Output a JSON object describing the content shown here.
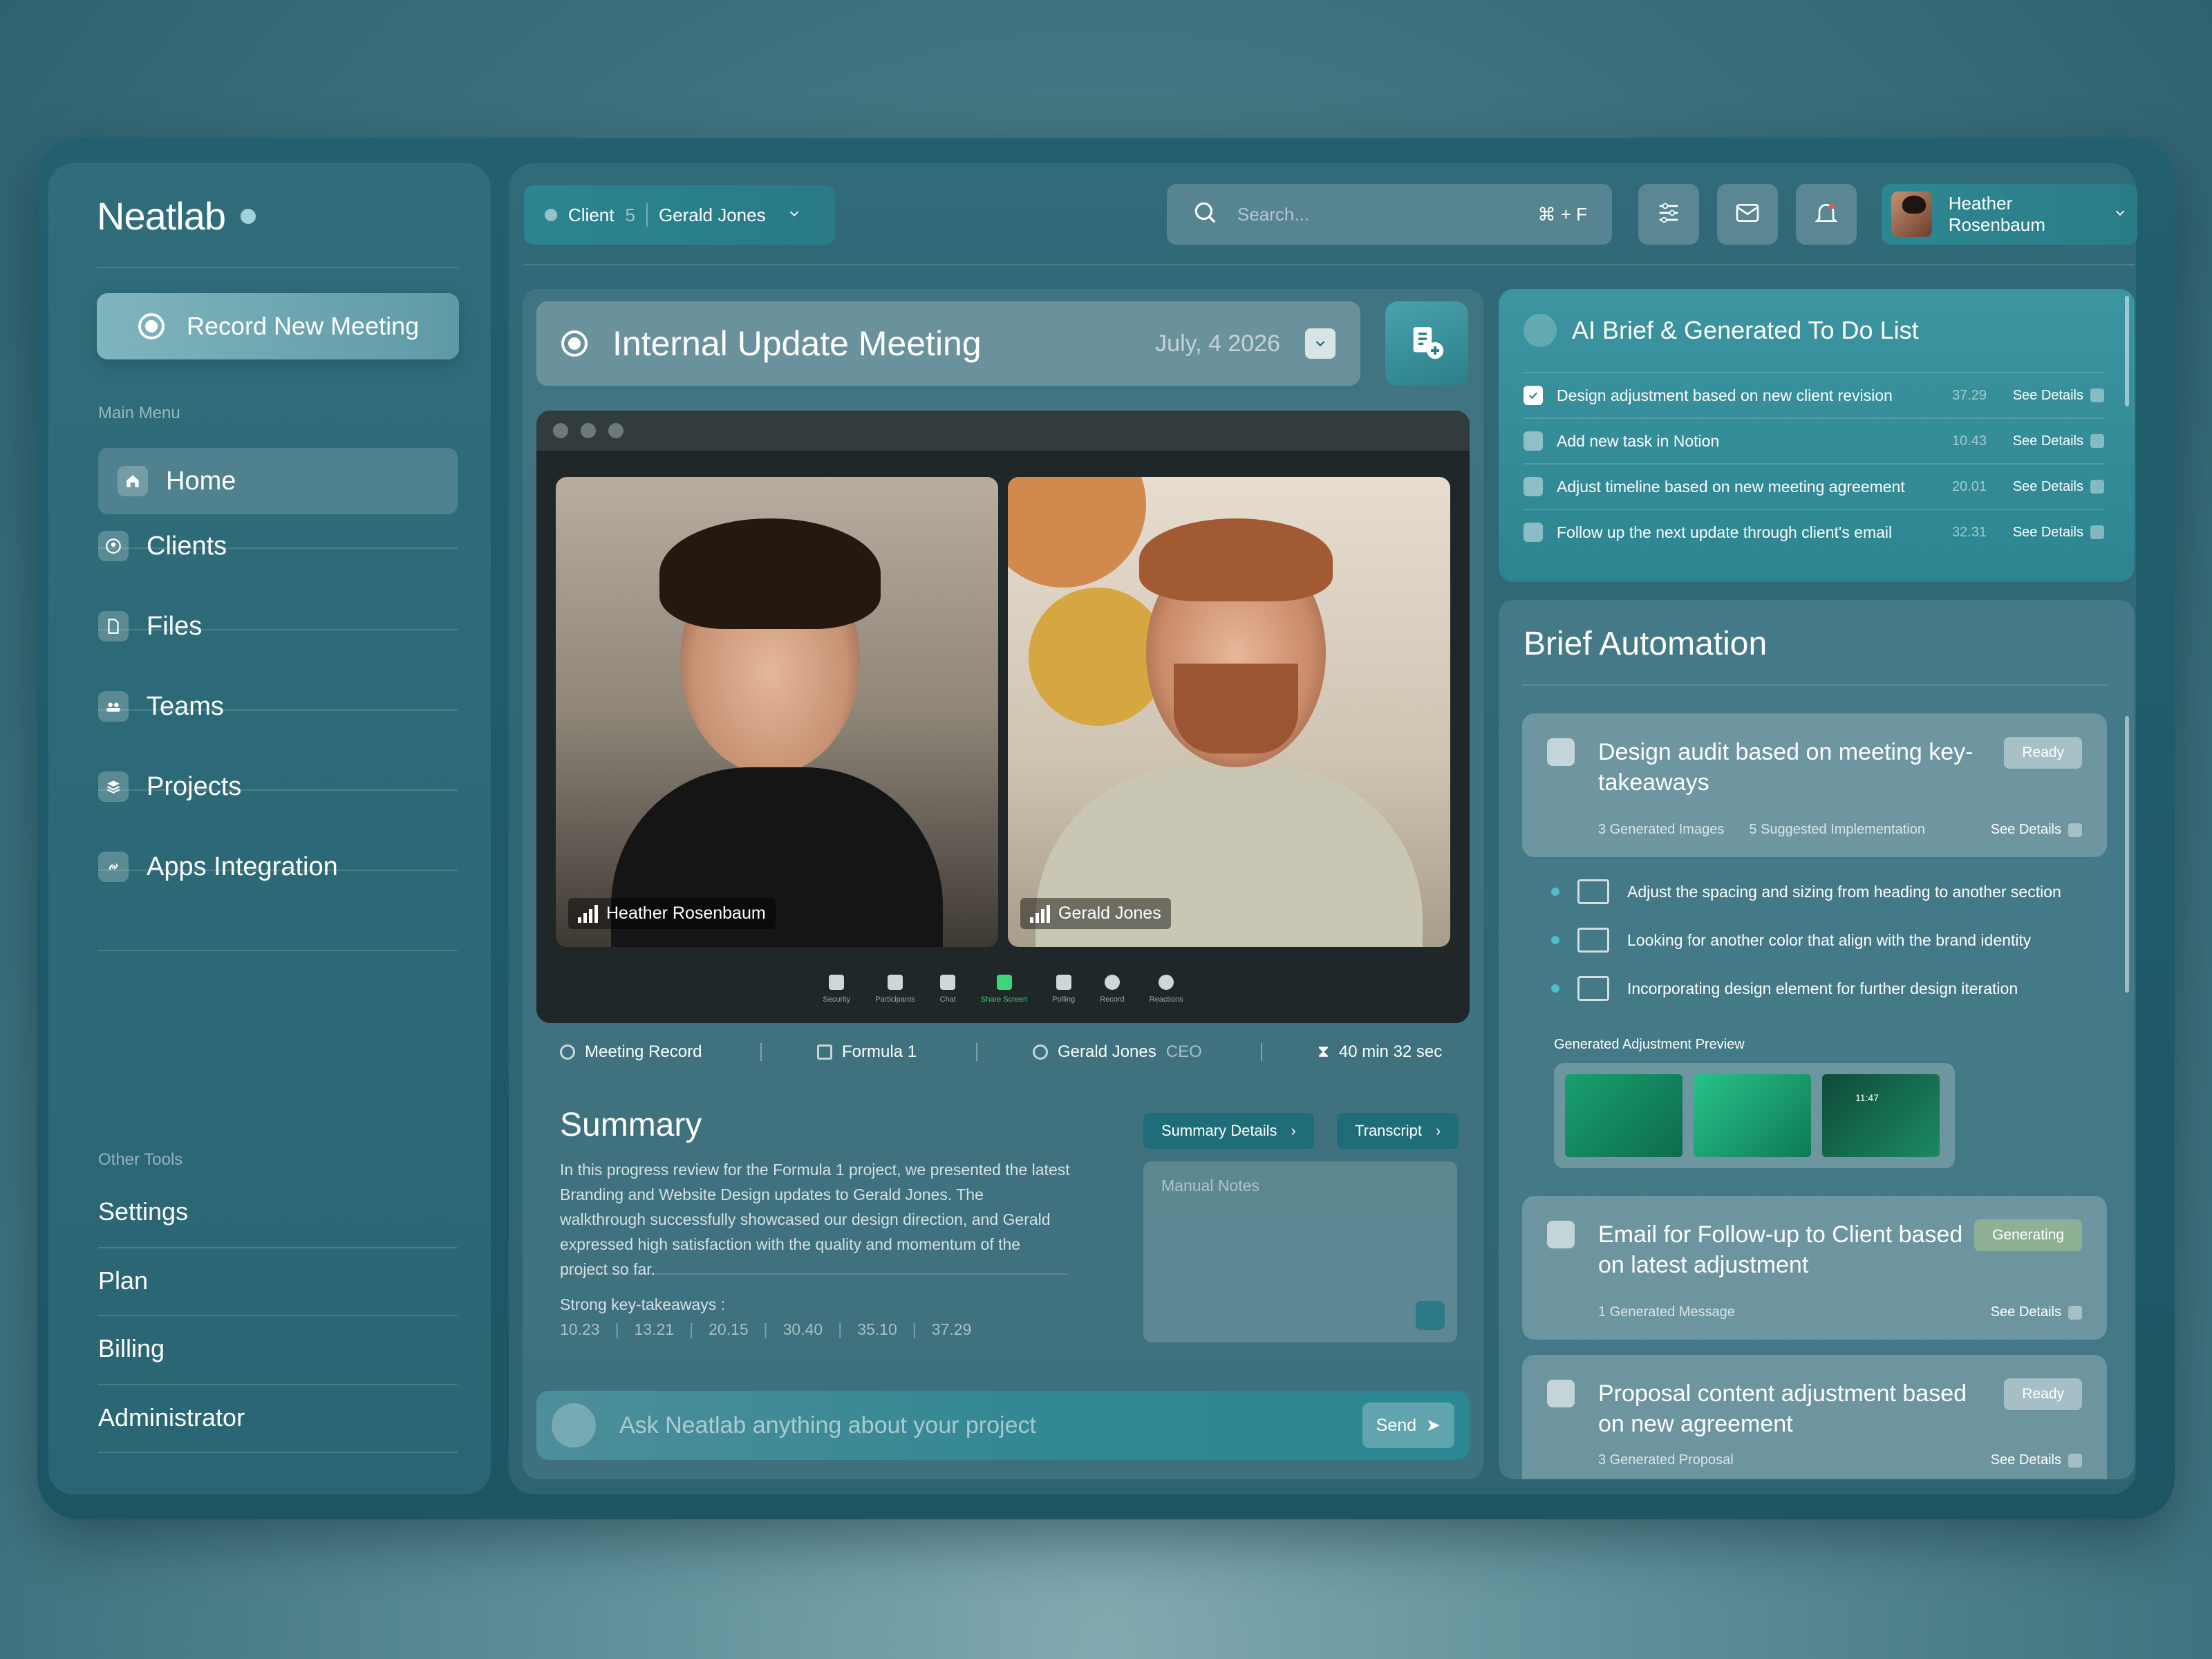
{
  "sidebar": {
    "brand": "Neatlab",
    "record_button": "Record New Meeting",
    "main_menu_label": "Main Menu",
    "items": [
      {
        "label": "Home",
        "icon": "home-icon"
      },
      {
        "label": "Clients",
        "icon": "user-circle-icon"
      },
      {
        "label": "Files",
        "icon": "file-icon"
      },
      {
        "label": "Teams",
        "icon": "team-icon"
      },
      {
        "label": "Projects",
        "icon": "layers-icon"
      },
      {
        "label": "Apps Integration",
        "icon": "link-icon"
      }
    ],
    "other_tools_label": "Other Tools",
    "tools": [
      "Settings",
      "Plan",
      "Billing",
      "Administrator"
    ]
  },
  "topbar": {
    "client_label": "Client",
    "client_count": "5",
    "client_name": "Gerald Jones",
    "search_placeholder": "Search...",
    "search_shortcut": "⌘ + F",
    "user_name": "Heather Rosenbaum"
  },
  "meeting": {
    "title": "Internal Update Meeting",
    "date": "July, 4 2026",
    "participants": [
      {
        "name": "Heather Rosenbaum"
      },
      {
        "name": "Gerald Jones"
      }
    ],
    "controls": [
      "Security",
      "Participants",
      "Chat",
      "Share Screen",
      "Polling",
      "Record",
      "Reactions"
    ],
    "meta": {
      "record": "Meeting Record",
      "project": "Formula 1",
      "person": "Gerald Jones",
      "role": "CEO",
      "duration": "40 min 32 sec"
    },
    "summary_title": "Summary",
    "summary_text": "In this progress review for the Formula 1 project, we presented the latest Branding and Website Design updates to Gerald Jones. The walkthrough successfully showcased our design direction, and Gerald expressed high satisfaction with the quality and momentum of the project so far.",
    "takeaways_label": "Strong key-takeaways :",
    "takeaways": [
      "10.23",
      "13.21",
      "20.15",
      "30.40",
      "35.10",
      "37.29"
    ],
    "summary_details_btn": "Summary Details",
    "transcript_btn": "Transcript",
    "notes_placeholder": "Manual Notes",
    "ask_placeholder": "Ask Neatlab anything about your project",
    "send_label": "Send"
  },
  "ai_brief": {
    "title": "AI Brief & Generated To Do List",
    "see_label": "See Details",
    "todos": [
      {
        "text": "Design adjustment based on new client revision",
        "time": "37.29",
        "checked": true
      },
      {
        "text": "Add new task in Notion",
        "time": "10.43",
        "checked": false
      },
      {
        "text": "Adjust timeline based on new meeting agreement",
        "time": "20.01",
        "checked": false
      },
      {
        "text": "Follow up the next update through client's email",
        "time": "32.31",
        "checked": false
      }
    ]
  },
  "automation": {
    "title": "Brief Automation",
    "see_label": "See Details",
    "cards": [
      {
        "title": "Design audit based on meeting key-takeaways",
        "status": "Ready",
        "meta": [
          "3 Generated Images",
          "5 Suggested Implementation"
        ]
      },
      {
        "title": "Email for Follow-up to Client based on latest adjustment",
        "status": "Generating",
        "meta": [
          "1 Generated Message"
        ]
      },
      {
        "title": "Proposal content adjustment based on new agreement",
        "status": "Ready",
        "meta": [
          "3 Generated Proposal"
        ]
      }
    ],
    "suggestions": [
      "Adjust the spacing and sizing from heading to another section",
      "Looking for another color that align with the brand identity",
      "Incorporating design element for further design iteration"
    ],
    "preview_label": "Generated Adjustment Preview",
    "preview_time": "11:47"
  },
  "colors": {
    "accent": "#2b8590",
    "frame": "#1d5563",
    "ready": "#ffffff",
    "generating": "#aac88c"
  }
}
